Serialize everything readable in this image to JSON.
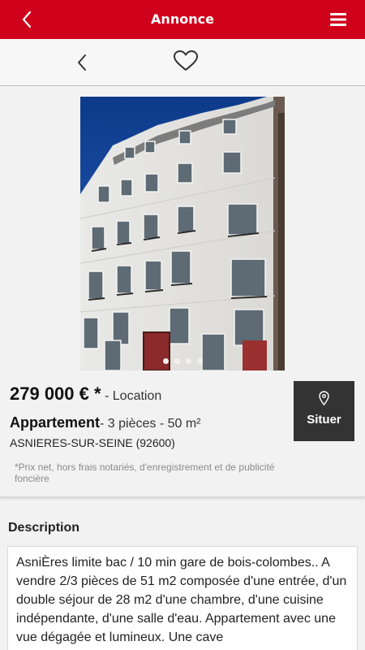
{
  "header": {
    "title": "Annonce",
    "back_icon": "chevron-left-icon",
    "menu_icon": "hamburger-menu-icon",
    "color": "#d0021b"
  },
  "subbar": {
    "prev_icon": "chevron-left-icon",
    "favorite_icon": "heart-outline-icon"
  },
  "gallery": {
    "slide_count": 4,
    "active_slide": 1
  },
  "listing": {
    "price": "279 000 € *",
    "transaction": " - Location",
    "property_type": "Appartement",
    "details": "- 3 pièces - 50 m²",
    "city": "ASNIERES-SUR-SEINE (92600)",
    "price_note": "*Prix net, hors frais notariés, d'enregistrement et de publicité foncière"
  },
  "locate_button": {
    "label": "Situer",
    "icon": "map-pin-icon"
  },
  "description": {
    "title": "Description",
    "text": "AsniÈres limite bac / 10 min gare de bois-colombes.. A vendre 2/3 pièces de 51 m2 composée d'une entrée, d'un double séjour de 28 m2 d'une chambre, d'une cuisine indépendante, d'une salle d'eau. Appartement avec une vue dégagée et lumineux. Une cave"
  }
}
